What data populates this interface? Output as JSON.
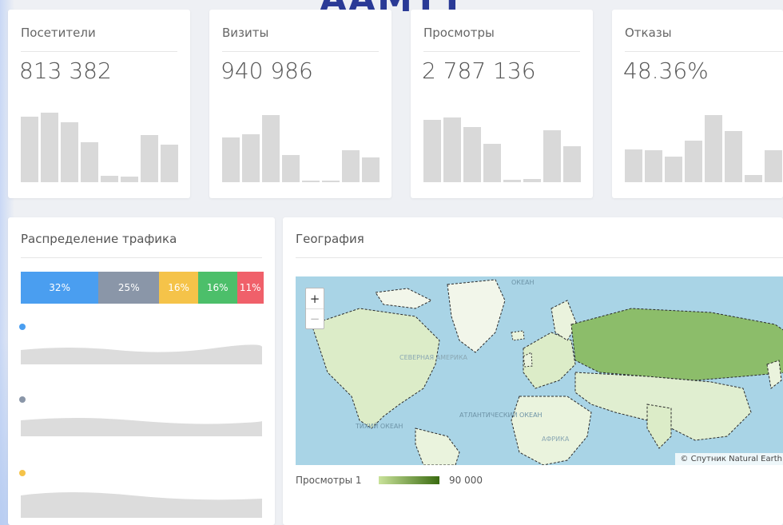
{
  "header": {
    "partial_text": "AAMTT"
  },
  "metrics": [
    {
      "title": "Посетители",
      "value": "813 382",
      "bars": [
        0.73,
        0.78,
        0.67,
        0.45,
        0.07,
        0.06,
        0.53,
        0.42
      ]
    },
    {
      "title": "Визиты",
      "value": "940 986",
      "bars": [
        0.5,
        0.54,
        0.75,
        0.3,
        0.01,
        0.01,
        0.36,
        0.28
      ]
    },
    {
      "title": "Просмотры",
      "value": "2 787 136",
      "bars": [
        0.7,
        0.72,
        0.62,
        0.43,
        0.03,
        0.04,
        0.58,
        0.4
      ]
    },
    {
      "title": "Отказы",
      "value": "48.36%",
      "bars": [
        0.37,
        0.36,
        0.29,
        0.46,
        0.75,
        0.57,
        0.08,
        0.36
      ]
    }
  ],
  "traffic": {
    "title": "Распределение трафика",
    "segments": [
      {
        "label": "32%",
        "share": 32,
        "color": "#4a9ef0"
      },
      {
        "label": "25%",
        "share": 25,
        "color": "#8a96a8"
      },
      {
        "label": "16%",
        "share": 16,
        "color": "#f5c349"
      },
      {
        "label": "16%",
        "share": 16,
        "color": "#4cbf6a"
      },
      {
        "label": "11%",
        "share": 11,
        "color": "#f0606a"
      }
    ],
    "legend_dots": [
      "#4a9ef0",
      "#8a96a8",
      "#f5c349"
    ]
  },
  "geo": {
    "title": "География",
    "zoom_in": "+",
    "zoom_out": "−",
    "map_labels": [
      "СЕВЕРНАЯ АМЕРИКА",
      "АТЛАНТИЧЕСКИЙ ОКЕАН",
      "ТИХИЙ ОКЕАН",
      "АФРИКА",
      "ОКЕАН"
    ],
    "attribution": "© Спутник   Natural Earth",
    "legend_label": "Просмотры 1",
    "legend_max": "90 000"
  }
}
